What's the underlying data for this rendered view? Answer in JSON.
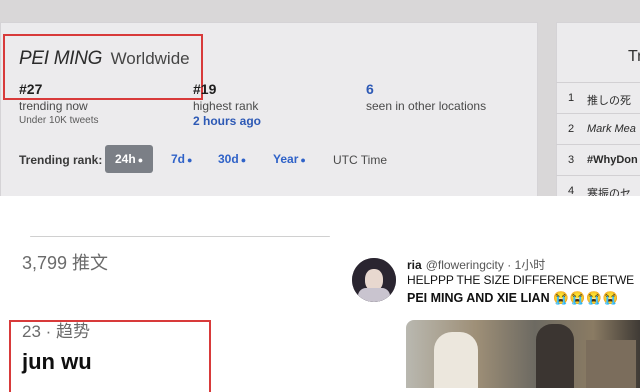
{
  "trend_card": {
    "name": "PEI MING",
    "region": "Worldwide",
    "stats": [
      {
        "value": "#27",
        "label": "trending now",
        "sub": "Under 10K tweets"
      },
      {
        "value": "#19",
        "label": "highest rank",
        "sub": "2 hours ago"
      },
      {
        "value": "6",
        "label": "seen in other locations"
      }
    ],
    "trending_rank_label": "Trending rank:",
    "rank_tabs": [
      {
        "label": "24h",
        "active": true
      },
      {
        "label": "7d",
        "active": false
      },
      {
        "label": "30d",
        "active": false
      },
      {
        "label": "Year",
        "active": false
      }
    ],
    "time_note": "UTC Time",
    "highlight_color": "#d83a3a",
    "link_color": "#2d59b5"
  },
  "side_list": {
    "header": "Tr",
    "rows": [
      {
        "num": "1",
        "text": "推しの死"
      },
      {
        "num": "2",
        "text": "Mark Mea"
      },
      {
        "num": "3",
        "text": "#WhyDon"
      },
      {
        "num": "4",
        "text": "寒振のセ"
      }
    ]
  },
  "trend_stats": {
    "tweets": "3,799 推文",
    "trend": "23 · 趋势",
    "trend_name": "jun wu"
  },
  "tweet": {
    "display_name": "ria",
    "handle": "@floweringcity",
    "time": "· 1小时",
    "text_line1": "HELPPP THE SIZE DIFFERENCE BETWE",
    "text_line2_bold": "PEI MING AND XIE LIAN",
    "emojis": "😭😭😭😭"
  }
}
